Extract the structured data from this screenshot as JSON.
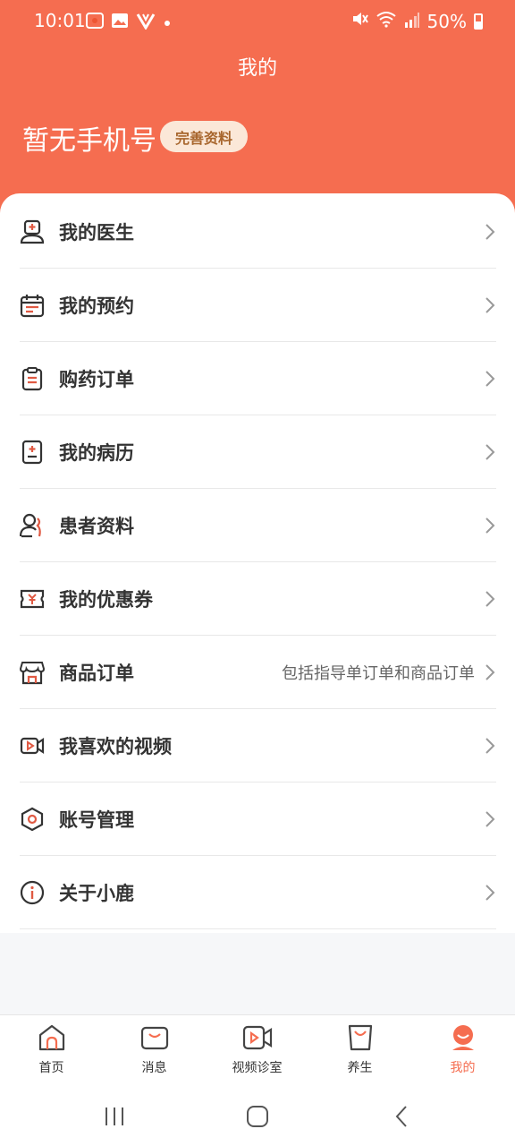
{
  "status": {
    "time": "10:01",
    "battery": "50%",
    "icons": [
      "notification-icon",
      "gallery-icon",
      "v-app-icon",
      "dot-icon",
      "mute-icon",
      "wifi-icon",
      "signal-icon",
      "battery-icon"
    ]
  },
  "header": {
    "title": "我的",
    "profile_name": "暂无手机号",
    "complete_label": "完善资料",
    "bg_color": "#f56d50"
  },
  "menu": {
    "items": [
      {
        "label": "我的医生",
        "icon": "doctor-icon"
      },
      {
        "label": "我的预约",
        "icon": "calendar-icon"
      },
      {
        "label": "购药订单",
        "icon": "clipboard-icon"
      },
      {
        "label": "我的病历",
        "icon": "medical-record-icon"
      },
      {
        "label": "患者资料",
        "icon": "patient-icon"
      },
      {
        "label": "我的优惠券",
        "icon": "coupon-icon"
      },
      {
        "label": "商品订单",
        "icon": "store-icon",
        "sub": "包括指导单订单和商品订单"
      },
      {
        "label": "我喜欢的视频",
        "icon": "video-icon"
      },
      {
        "label": "账号管理",
        "icon": "settings-hex-icon"
      },
      {
        "label": "关于小鹿",
        "icon": "info-icon"
      }
    ]
  },
  "tabs": [
    {
      "label": "首页",
      "icon": "home-icon"
    },
    {
      "label": "消息",
      "icon": "message-icon"
    },
    {
      "label": "视频诊室",
      "icon": "video-clinic-icon"
    },
    {
      "label": "养生",
      "icon": "shopping-bag-icon"
    },
    {
      "label": "我的",
      "icon": "profile-icon",
      "active": true
    }
  ],
  "accent_color": "#f56d50"
}
